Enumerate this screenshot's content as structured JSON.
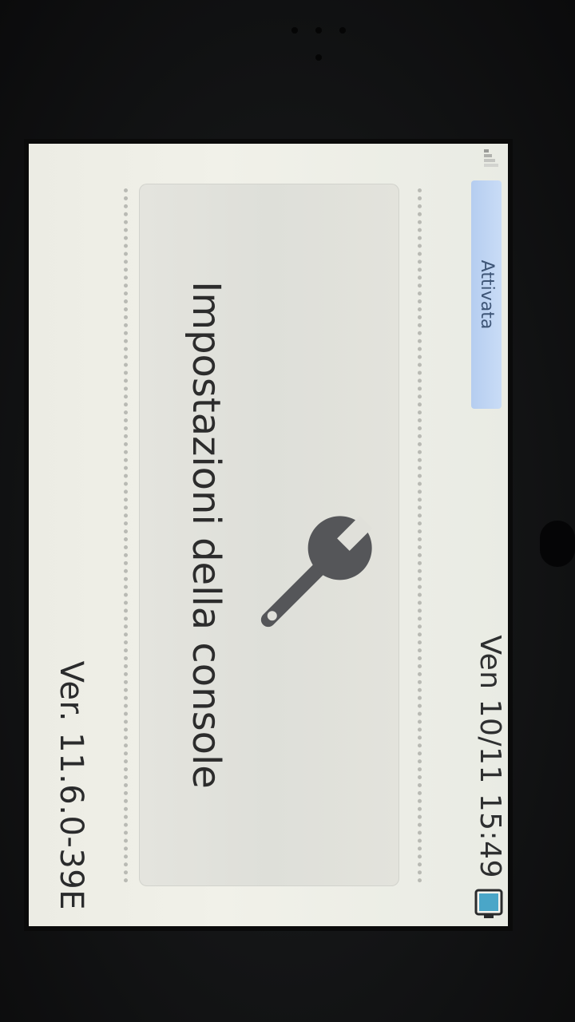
{
  "status": {
    "wifi_label": "Attivata",
    "datetime": "Ven 10/11  15:49"
  },
  "panel": {
    "title": "Impostazioni della console",
    "icon": "wrench-icon"
  },
  "footer": {
    "version": "Ver. 11.6.0-39E"
  },
  "colors": {
    "screen_bg": "#efefe8",
    "panel_bg": "#e0e0da",
    "badge_bg": "#bfd4f3",
    "badge_text": "#3e5576",
    "battery": "#4aa6c8",
    "wrench": "#555659"
  }
}
